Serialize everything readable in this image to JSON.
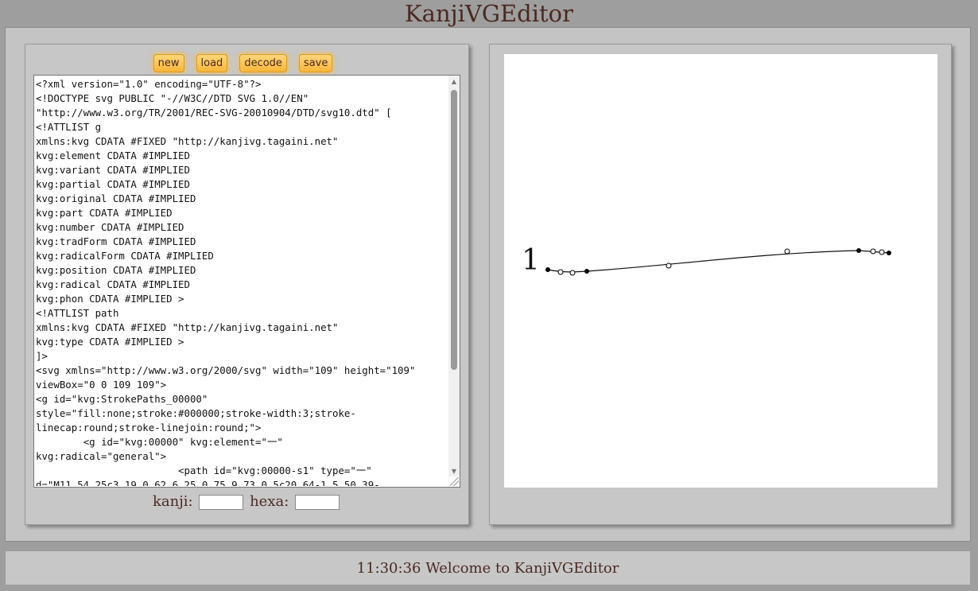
{
  "app": {
    "title": "KanjiVGEditor"
  },
  "toolbar": {
    "new": "new",
    "load": "load",
    "decode": "decode",
    "save": "save"
  },
  "editor": {
    "content": "<?xml version=\"1.0\" encoding=\"UTF-8\"?>\n<!DOCTYPE svg PUBLIC \"-//W3C//DTD SVG 1.0//EN\"\n\"http://www.w3.org/TR/2001/REC-SVG-20010904/DTD/svg10.dtd\" [\n<!ATTLIST g\nxmlns:kvg CDATA #FIXED \"http://kanjivg.tagaini.net\"\nkvg:element CDATA #IMPLIED\nkvg:variant CDATA #IMPLIED\nkvg:partial CDATA #IMPLIED\nkvg:original CDATA #IMPLIED\nkvg:part CDATA #IMPLIED\nkvg:number CDATA #IMPLIED\nkvg:tradForm CDATA #IMPLIED\nkvg:radicalForm CDATA #IMPLIED\nkvg:position CDATA #IMPLIED\nkvg:radical CDATA #IMPLIED\nkvg:phon CDATA #IMPLIED >\n<!ATTLIST path\nxmlns:kvg CDATA #FIXED \"http://kanjivg.tagaini.net\"\nkvg:type CDATA #IMPLIED >\n]>\n<svg xmlns=\"http://www.w3.org/2000/svg\" width=\"109\" height=\"109\"\nviewBox=\"0 0 109 109\">\n<g id=\"kvg:StrokePaths_00000\"\nstyle=\"fill:none;stroke:#000000;stroke-width:3;stroke-\nlinecap:round;stroke-linejoin:round;\">\n        <g id=\"kvg:00000\" kvg:element=\"一\"\nkvg:radical=\"general\">\n                        <path id=\"kvg:00000-s1\" type=\"一\"\nd=\"M11.54,25c3.19,0.62,6.25,0.75,9.73,0.5c20.64-1.5,50.39-"
  },
  "fields": {
    "kanji_label": "kanji:",
    "hexa_label": "hexa:",
    "kanji_value": "",
    "hexa_value": ""
  },
  "canvas": {
    "stroke_number": "1"
  },
  "status": {
    "message": "11:30:36 Welcome to KanjiVGEditor"
  }
}
